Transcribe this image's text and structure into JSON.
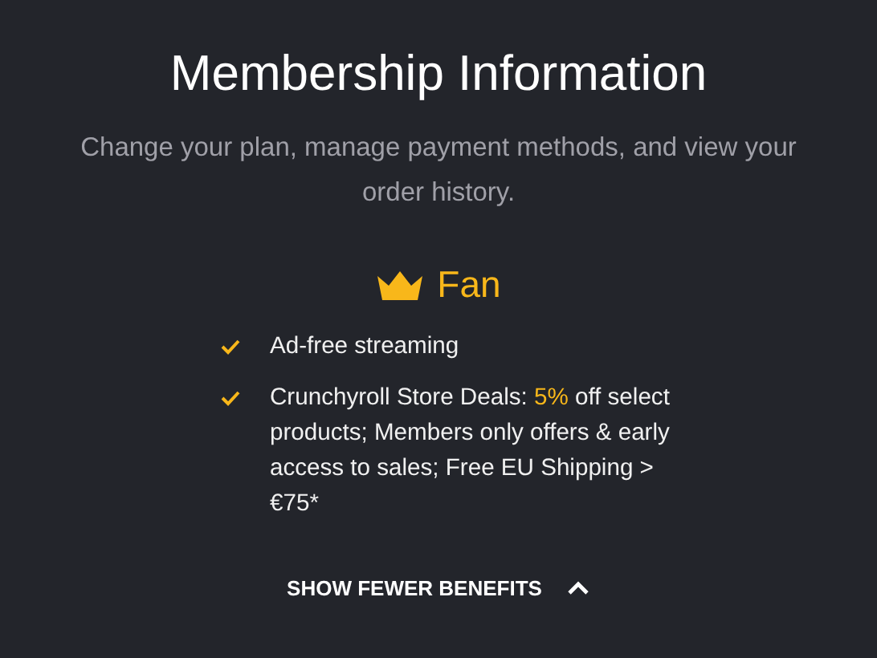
{
  "title": "Membership Information",
  "subtitle": "Change your plan, manage payment methods, and view your order history.",
  "plan": {
    "name": "Fan"
  },
  "benefits": [
    {
      "parts": [
        {
          "text": "Ad-free streaming",
          "highlight": false
        }
      ]
    },
    {
      "parts": [
        {
          "text": "Crunchyroll Store Deals: ",
          "highlight": false
        },
        {
          "text": "5%",
          "highlight": true
        },
        {
          "text": " off select products; Members only offers & early access to sales; Free EU Shipping > €75*",
          "highlight": false
        }
      ]
    }
  ],
  "toggle": {
    "label": "SHOW FEWER BENEFITS",
    "expanded": true
  }
}
